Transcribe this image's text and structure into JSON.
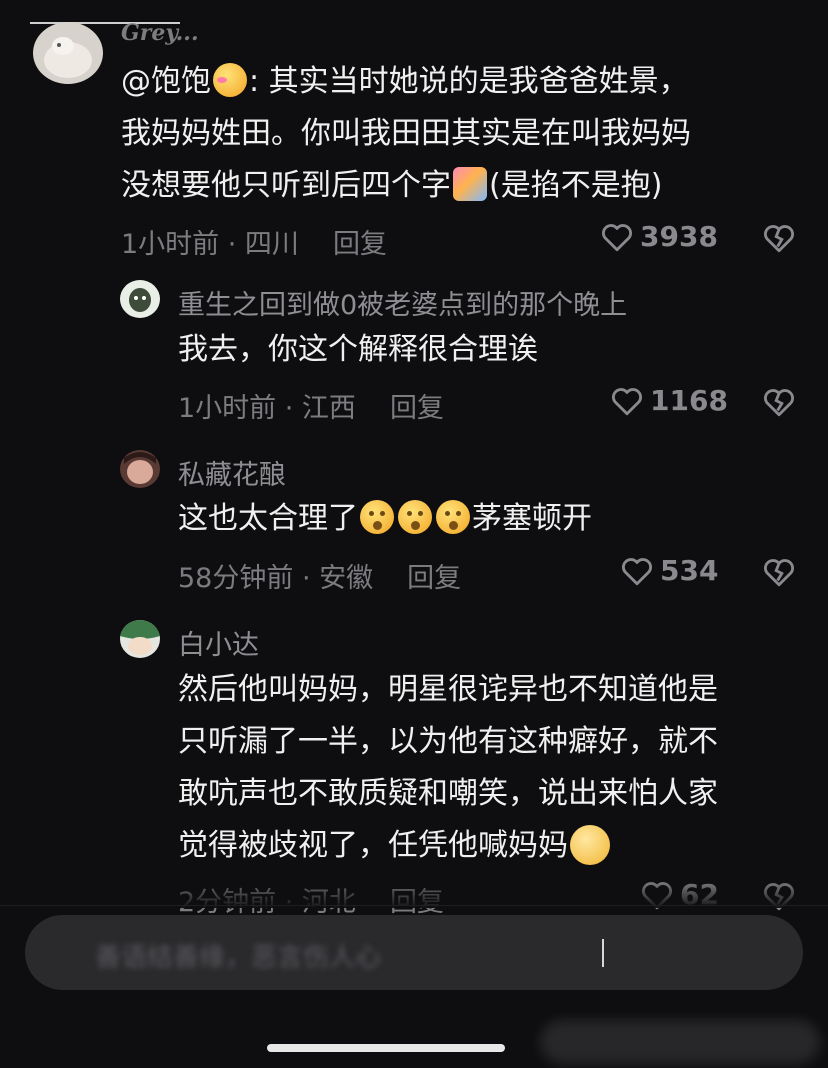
{
  "comments": [
    {
      "author": "Grey...",
      "lines": [
        "@饱饱",
        ": 其实当时她说的是我爸爸姓景，",
        "我妈妈姓田。你叫我田田其实是在叫我妈妈",
        "没想要他只听到后四个字",
        "(是掐不是抱)"
      ],
      "time": "1小时前 · 四川",
      "reply": "回复",
      "likes": "3938"
    },
    {
      "author": "重生之回到做0被老婆点到的那个晚上",
      "lines": [
        "我去，你这个解释很合理诶"
      ],
      "time": "1小时前 · 江西",
      "reply": "回复",
      "likes": "1168"
    },
    {
      "author": "私藏花酿",
      "lines": [
        "这也太合理了",
        "茅塞顿开"
      ],
      "time": "58分钟前 · 安徽",
      "reply": "回复",
      "likes": "534"
    },
    {
      "author": "白小达",
      "lines": [
        "然后他叫妈妈，明星很诧异也不知道他是",
        "只听漏了一半，以为他有这种癖好，就不",
        "敢吭声也不敢质疑和嘲笑，说出来怕人家",
        "觉得被歧视了，任凭他喊妈妈"
      ],
      "time": "2分钟前 · 河北",
      "reply": "回复",
      "likes": "62"
    }
  ],
  "input": {
    "placeholder": "善语结善缘，恶言伤人心"
  },
  "icons": {
    "like": "heart-outline-icon",
    "dislike": "broken-heart-icon"
  },
  "colors": {
    "background": "#0e0e10",
    "text": "#f0f0f0",
    "meta": "#7c7c80"
  }
}
